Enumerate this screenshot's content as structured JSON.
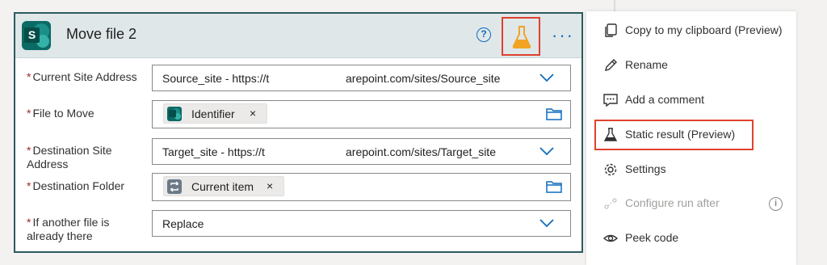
{
  "card": {
    "title": "Move file 2",
    "help_glyph": "?",
    "more_glyph": "···",
    "logo_letter": "S",
    "accent": "#0f6cbd",
    "flask_color": "#f2a324",
    "highlight_color": "#e0412f"
  },
  "fields": [
    {
      "label": "Current Site Address",
      "value_start": "Source_site - https://t",
      "value_end": "arepoint.com/sites/Source_site",
      "control": "dropdown"
    },
    {
      "label": "File to Move",
      "token": "Identifier",
      "token_icon": "sharepoint-icon",
      "control": "folder-picker"
    },
    {
      "label_line1": "Destination Site",
      "label_line2": "Address",
      "value_start": "Target_site - https://t",
      "value_end": "arepoint.com/sites/Target_site",
      "control": "dropdown"
    },
    {
      "label": "Destination Folder",
      "token": "Current item",
      "token_icon": "loop-icon",
      "control": "folder-picker"
    },
    {
      "label_line1": "If another file is",
      "label_line2": "already there",
      "value": "Replace",
      "control": "dropdown"
    }
  ],
  "required_mark": "*",
  "token_remove": "×",
  "menu": {
    "items": [
      {
        "label": "Copy to my clipboard (Preview)",
        "icon": "copy-icon",
        "enabled": true
      },
      {
        "label": "Rename",
        "icon": "pencil-icon",
        "enabled": true
      },
      {
        "label": "Add a comment",
        "icon": "comment-icon",
        "enabled": true
      },
      {
        "label": "Static result (Preview)",
        "icon": "flask-icon",
        "enabled": true
      },
      {
        "label": "Settings",
        "icon": "gear-icon",
        "enabled": true
      },
      {
        "label": "Configure run after",
        "icon": "run-after-icon",
        "enabled": false
      },
      {
        "label": "Peek code",
        "icon": "eye-icon",
        "enabled": true
      }
    ],
    "info_glyph": "i"
  }
}
